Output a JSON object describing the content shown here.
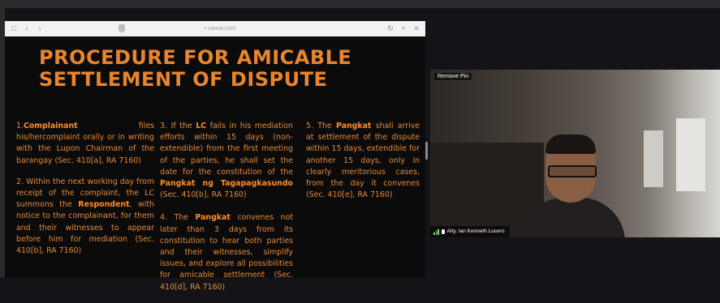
{
  "browser": {
    "url": "• canva.com",
    "nav_glyphs": [
      "□",
      "‹",
      "›"
    ],
    "right_glyphs": [
      "↻",
      "+",
      "≡"
    ]
  },
  "slide": {
    "title": "PROCEDURE FOR AMICABLE SETTLEMENT OF DISPUTE",
    "col1": {
      "p1_num": "1.",
      "p1_bold": "Complainant",
      "p1_rest": " files his/hercomplaint orally or in writing with the Lupon Chairman of the barangay (Sec. 410[a], RA 7160)",
      "p2_start": "2. Within the next working day from receipt of the complaint, the LC summons the ",
      "p2_bold": "Respondent",
      "p2_rest": ", with notice to the complainant, for them and their witnesses to appear before him for mediation (Sec. 410[b], RA 7160)"
    },
    "col2": {
      "p3_start": "3. If the ",
      "p3_bold1": "LC",
      "p3_mid": " fails in his mediation efforts within 15 days (non-extendible) from the first meeting of the parties, he shall set the date for the constitution of the ",
      "p3_bold2": "Pangkat ng Tagapagkasundo",
      "p3_rest": " (Sec. 410[b], RA 7160)",
      "p4_start": "4. The ",
      "p4_bold": "Pangkat",
      "p4_rest": " convenes not later than 3 days from its constitution to hear both parties and their witnesses, simplify issues, and explore all possibilities for amicable settlement (Sec. 410[d], RA 7160)"
    },
    "col3": {
      "p5_start": "5. The ",
      "p5_bold": "Pangkat",
      "p5_rest": " shall arrive at settlement of the dispute within 15 days, extendible for another 15 days, only in clearly meritorious cases, from the day it convenes (Sec. 410[e], RA 7160)"
    }
  },
  "video": {
    "remove_pin_label": "Remove Pin",
    "participant_name": "Atty. Ian Kenneth Lucero"
  },
  "colors": {
    "title": "#e8852f",
    "body_text": "#e48a3c",
    "slide_bg": "#0b0b0b",
    "page_bg": "#141418"
  }
}
